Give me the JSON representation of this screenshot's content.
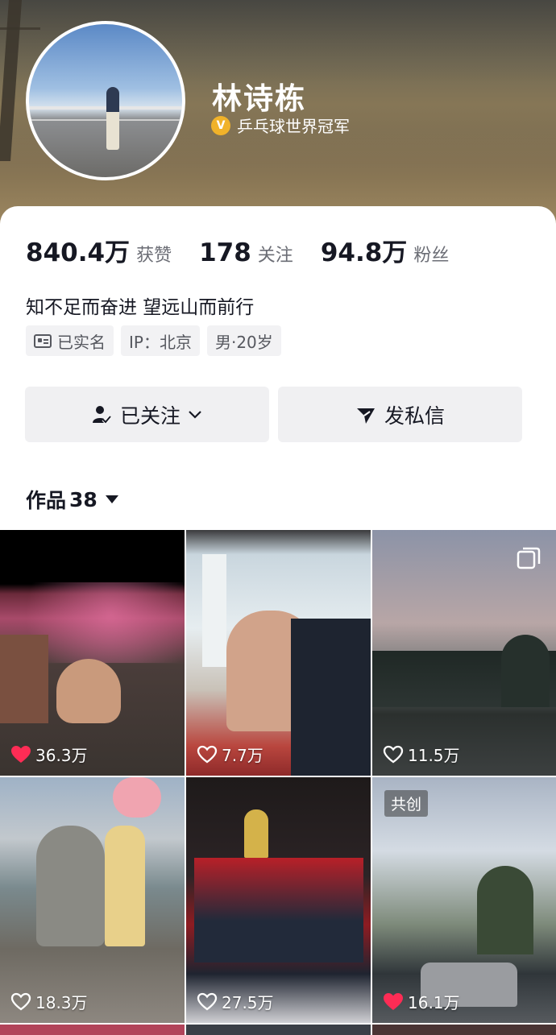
{
  "profile": {
    "name": "林诗栋",
    "verify_badge": "V",
    "verification": "乒乓球世界冠军"
  },
  "stats": [
    {
      "value": "840.4万",
      "label": "获赞"
    },
    {
      "value": "178",
      "label": "关注"
    },
    {
      "value": "94.8万",
      "label": "粉丝"
    }
  ],
  "bio": "知不足而奋进 望远山而前行",
  "tags": {
    "realname": "已实名",
    "ip": "IP：北京",
    "gender_age": "男·20岁"
  },
  "actions": {
    "follow_label": "已关注",
    "message_label": "发私信"
  },
  "works": {
    "label": "作品",
    "count": "38"
  },
  "grid": [
    {
      "likes": "36.3万",
      "liked": true
    },
    {
      "likes": "7.7万",
      "liked": false
    },
    {
      "likes": "11.5万",
      "liked": false,
      "multi": true
    },
    {
      "likes": "18.3万",
      "liked": false
    },
    {
      "likes": "27.5万",
      "liked": false
    },
    {
      "likes": "16.1万",
      "liked": true,
      "tag": "共创"
    }
  ],
  "colors": {
    "like_red": "#fe2c55",
    "verify_gold": "#f0b22a",
    "text_primary": "#161823",
    "text_secondary": "#6b6d75"
  }
}
